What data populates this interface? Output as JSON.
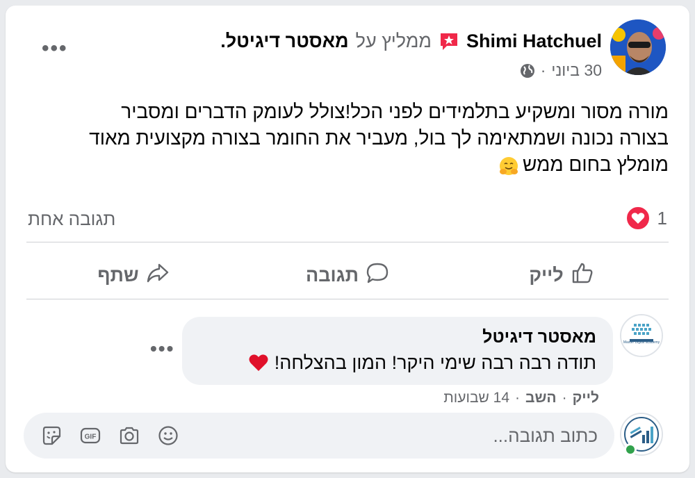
{
  "post": {
    "author": "Shimi Hatchuel",
    "recommend_text": "ממליץ על",
    "page_name": "מאסטר דיגיטל.",
    "date": "30 ביוני",
    "separator": "·",
    "body_lines": [
      "מורה מסור ומשקיע בתלמידים לפני הכל!צולל לעומק הדברים ומסביר",
      "בצורה נכונה ושמתאימה לך בול, מעביר את החומר בצורה מקצועית מאוד",
      "מומלץ בחום ממש"
    ],
    "reaction_count": "1",
    "comments_count": "תגובה אחת"
  },
  "actions": {
    "like": "לייק",
    "comment": "תגובה",
    "share": "שתף"
  },
  "comment": {
    "author": "מאסטר דיגיטל",
    "text": "תודה רבה רבה שימי היקר! המון בהצלחה!",
    "like": "לייק",
    "reply": "השב",
    "time": "14 שבועות",
    "avatar_caption": "Master Digital academy"
  },
  "reply_box": {
    "placeholder": "כתוב תגובה..."
  },
  "colors": {
    "heart": "#f0284a",
    "recommend": "#f02849",
    "secondary_text": "#65676b",
    "bubble": "#f0f2f5"
  },
  "icons": [
    "more-icon",
    "globe-icon",
    "recommend-icon",
    "heart-reaction-icon",
    "like-icon",
    "comment-icon",
    "share-icon",
    "sticker-icon",
    "gif-icon",
    "camera-icon",
    "emoji-icon"
  ]
}
